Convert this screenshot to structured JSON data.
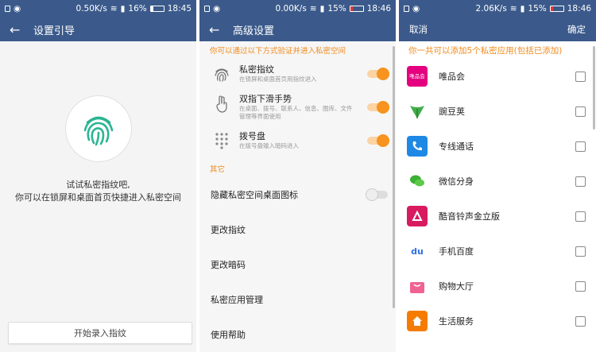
{
  "status": {
    "p1": {
      "speed": "0.50K/s",
      "battery": "16%",
      "time": "18:45"
    },
    "p2": {
      "speed": "0.00K/s",
      "battery": "15%",
      "time": "18:46"
    },
    "p3": {
      "speed": "2.06K/s",
      "battery": "15%",
      "time": "18:46"
    }
  },
  "setup": {
    "title": "设置引导",
    "hint_line1": "试试私密指纹吧,",
    "hint_line2": "你可以在锁屏和桌面首页快捷进入私密空间",
    "start_button": "开始录入指纹"
  },
  "advanced": {
    "title": "高级设置",
    "section_verify": "你可以通过以下方式验证并进入私密空间",
    "options": [
      {
        "title": "私密指纹",
        "desc": "在锁屏和桌面首页用指纹进入",
        "icon": "fingerprint-icon",
        "enabled": true
      },
      {
        "title": "双指下滑手势",
        "desc": "在桌面、拨号、联系人、信息、图库、文件管理等界面使用",
        "icon": "two-finger-gesture-icon",
        "enabled": true
      },
      {
        "title": "拨号盘",
        "desc": "在拨号盘输入暗码进入",
        "icon": "dialpad-icon",
        "enabled": true
      }
    ],
    "section_other": "其它",
    "hide_icon_label": "隐藏私密空间桌面图标",
    "hide_icon_enabled": false,
    "items": [
      "更改指纹",
      "更改暗码",
      "私密应用管理",
      "使用帮助"
    ]
  },
  "picker": {
    "cancel": "取消",
    "confirm": "确定",
    "note": "你一共可以添加5个私密应用(包括已添加)",
    "apps": [
      {
        "name": "唯品会",
        "icon": "vipshop-icon",
        "color": "#e4007f",
        "label": "唯品会"
      },
      {
        "name": "豌豆荚",
        "icon": "wandoujia-icon",
        "color": "#ffffff",
        "label": ""
      },
      {
        "name": "专线通话",
        "icon": "phone-icon",
        "color": "#1e88e5",
        "label": ""
      },
      {
        "name": "微信分身",
        "icon": "wechat-icon",
        "color": "#ffffff",
        "label": ""
      },
      {
        "name": "酷音铃声金立版",
        "icon": "ringtone-icon",
        "color": "#d81b60",
        "label": ""
      },
      {
        "name": "手机百度",
        "icon": "baidu-icon",
        "color": "#ffffff",
        "label": "du"
      },
      {
        "name": "购物大厅",
        "icon": "shopping-icon",
        "color": "#ffffff",
        "label": ""
      },
      {
        "name": "生活服务",
        "icon": "home-service-icon",
        "color": "#f57c00",
        "label": ""
      }
    ]
  },
  "colors": {
    "bar": "#3b5a8b",
    "accent": "#f7931e"
  }
}
